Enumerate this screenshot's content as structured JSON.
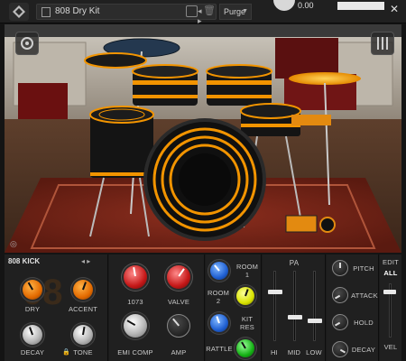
{
  "topbar": {
    "preset_name": "808 Dry Kit",
    "purge_label": "Purge",
    "tune_value": "0.00"
  },
  "icons": [
    "logo-icon",
    "preset-icon",
    "save-icon",
    "trash-icon",
    "close-icon",
    "settings-icon",
    "mixer-icon"
  ],
  "instrument": {
    "name": "808 KICK",
    "knobs": [
      {
        "label": "DRY",
        "color": "orange"
      },
      {
        "label": "ACCENT",
        "color": "orange"
      },
      {
        "label": "DECAY",
        "color": "silver"
      },
      {
        "label": "TONE",
        "color": "silver"
      }
    ]
  },
  "channel": {
    "items": [
      {
        "label": "1073",
        "color": "#c51818"
      },
      {
        "label": "VALVE",
        "color": "#c51818"
      },
      {
        "label": "EMI COMP",
        "color": "#b8b8b8"
      },
      {
        "label": "AMP",
        "color": "#b8b8b8"
      }
    ]
  },
  "room": {
    "items": [
      {
        "label": "ROOM 1",
        "color": "blue"
      },
      {
        "label": "ROOM 2",
        "color": "yellow"
      },
      {
        "label": "KIT RES",
        "color": "blue"
      },
      {
        "label": "RATTLE",
        "color": "green"
      }
    ],
    "room1_line1": "ROOM",
    "room1_line2": "1",
    "room2_line1": "ROOM",
    "room2_line2": "2",
    "kitres_line1": "KIT",
    "kitres_line2": "RES",
    "rattle": "RATTLE"
  },
  "pa": {
    "title": "PA",
    "faders": [
      {
        "label": "HI",
        "level": 0.7
      },
      {
        "label": "MID",
        "level": 0.35
      },
      {
        "label": "LOW",
        "level": 0.3
      }
    ]
  },
  "envelope": {
    "knobs": [
      {
        "label": "PITCH"
      },
      {
        "label": "ATTACK"
      },
      {
        "label": "HOLD"
      },
      {
        "label": "DECAY"
      }
    ]
  },
  "edit": {
    "edit_label": "EDIT",
    "all_label": "ALL",
    "vel_label": "VEL",
    "level": 0.85
  },
  "colors": {
    "accent_orange": "#f29400",
    "panel_bg": "#202020",
    "stage_rug": "#7a2418"
  }
}
